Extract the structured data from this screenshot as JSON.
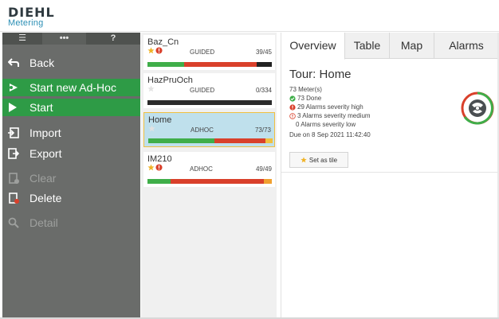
{
  "brand": {
    "name": "DIEHL",
    "sub": "Metering"
  },
  "sidebar": {
    "tabs": [
      {
        "icon": "menu-icon",
        "label": "☰"
      },
      {
        "icon": "more-icon",
        "label": "•••"
      },
      {
        "icon": "help-icon",
        "label": "?"
      }
    ],
    "items": [
      {
        "label": "Back",
        "icon": "back-arrow-icon",
        "state": "normal"
      },
      {
        "label": "Start new Ad-Hoc",
        "icon": "start-adhoc-icon",
        "state": "active"
      },
      {
        "label": "Start",
        "icon": "play-icon",
        "state": "active"
      },
      {
        "label": "Import",
        "icon": "import-icon",
        "state": "normal"
      },
      {
        "label": "Export",
        "icon": "export-icon",
        "state": "normal"
      },
      {
        "label": "Clear",
        "icon": "clear-icon",
        "state": "disabled"
      },
      {
        "label": "Delete",
        "icon": "delete-icon",
        "state": "normal"
      },
      {
        "label": "Detail",
        "icon": "search-icon",
        "state": "disabled"
      }
    ]
  },
  "tours": [
    {
      "name": "Baz_Cn",
      "type": "GUIDED",
      "count": "39/45",
      "starred": true,
      "alarm": true,
      "segments": [
        {
          "color": "#3fae49",
          "flex": 7
        },
        {
          "color": "#d9402b",
          "flex": 14
        },
        {
          "color": "#222222",
          "flex": 3
        }
      ]
    },
    {
      "name": "HazPruOch",
      "type": "GUIDED",
      "count": "0/334",
      "starred": false,
      "alarm": false,
      "segments": [
        {
          "color": "#2a2a2a",
          "flex": 1
        }
      ]
    },
    {
      "name": "Home",
      "type": "ADHOC",
      "count": "73/73",
      "starred": false,
      "alarm": false,
      "selected": true,
      "segments": [
        {
          "color": "#3fae49",
          "flex": 9
        },
        {
          "color": "#d9402b",
          "flex": 7
        },
        {
          "color": "#f0c040",
          "flex": 1
        }
      ]
    },
    {
      "name": "IM210",
      "type": "ADHOC",
      "count": "49/49",
      "starred": true,
      "alarm": true,
      "segments": [
        {
          "color": "#3fae49",
          "flex": 3
        },
        {
          "color": "#d9402b",
          "flex": 12
        },
        {
          "color": "#f0a030",
          "flex": 1
        }
      ]
    }
  ],
  "detail": {
    "tabs": [
      "Overview",
      "Table",
      "Map",
      "Alarms"
    ],
    "title": "Tour: Home",
    "meters": "73 Meter(s)",
    "done": "73 Done",
    "alarms_high": "29 Alarms severity high",
    "alarms_medium": "3 Alarms severity medium",
    "alarms_low": "0 Alarms severity low",
    "due": "Due on 8 Sep 2021 11:42:40",
    "set_tile_label": "Set as tile"
  },
  "colors": {
    "sidebar_bg": "#6a6c6a",
    "sidebar_active": "#2e9b46",
    "accent_blue": "#2b8fb5",
    "done_green": "#3fae49",
    "alarm_red": "#d9402b",
    "warning_yellow": "#f0c040"
  }
}
